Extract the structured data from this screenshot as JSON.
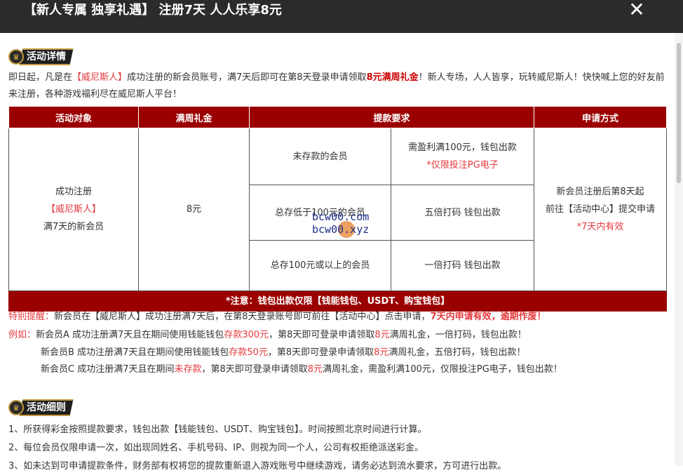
{
  "header": {
    "title": "【新人专属 独享礼遇】 注册7天 人人乐享8元",
    "close_label": "✕"
  },
  "section1": {
    "badge_label": "活动详情",
    "intro_1": "即日起，凡是在",
    "intro_brand": "【威尼斯人】",
    "intro_2": "成功注册的新会员账号，满7天后即可在第8天登录申请领取",
    "intro_gift": "8元满周礼金",
    "intro_3": "！新人专场，人人皆享，玩转威尼斯人！快快喊上您的好友前来注册，各种游戏福利尽在威尼斯人平台！"
  },
  "table": {
    "headers": [
      "活动对象",
      "满周礼金",
      "提款要求",
      "申请方式"
    ],
    "target_1": "成功注册",
    "target_brand": "【威尼斯人】",
    "target_2": "满7天的新会员",
    "amount": "8元",
    "rows": [
      {
        "condition": "未存款的会员",
        "req_1": "需盈利满100元，钱包出款",
        "req_2": "*仅限投注PG电子"
      },
      {
        "condition": "总存低于100元的会员",
        "req_1": "五倍打码 钱包出款",
        "req_2": ""
      },
      {
        "condition": "总存100元或以上的会员",
        "req_1": "一倍打码 钱包出款",
        "req_2": ""
      }
    ],
    "apply_1": "新会员注册后第8天起",
    "apply_2": "前往【活动中心】提交申请",
    "apply_3": "*7天内有效",
    "note": "*注意：钱包出款仅限【钱能钱包、USDT、购宝钱包】"
  },
  "reminder": {
    "label": "特别提醒：",
    "text": "新会员在【威尼斯人】成功注册满7天后，在第8天登录账号即可前往【活动中心】点击申请，",
    "emphasis": "7天内申请有效，逾期作废！"
  },
  "examples": {
    "label": "例如：",
    "a_1": "新会员A  成功注册满7天且在期间使用钱能钱包",
    "a_dep": "存款300元",
    "a_2": "，第8天即可登录申请领取",
    "a_amt": "8元",
    "a_3": "满周礼金，一倍打码，钱包出款！",
    "b_1": "新会员B  成功注册满7天且在期间使用钱能钱包",
    "b_dep": "存款50元",
    "b_2": "，第8天即可登录申请领取",
    "b_amt": "8元",
    "b_3": "满周礼金，五倍打码，钱包出款！",
    "c_1": "新会员C  成功注册满7天且在期间",
    "c_dep": "未存款",
    "c_2": "，第8天即可登录申请领取",
    "c_amt": "8元",
    "c_3": "满周礼金，需盈利满100元，仅限投注PG电子，钱包出款！"
  },
  "section2": {
    "badge_label": "活动细则",
    "rule_1": "1、所获得彩金按照提款要求，钱包出款【钱能钱包、USDT、购宝钱包】。时间按照北京时间进行计算。",
    "rule_2": "2、每位会员仅限申请一次，如出现同姓名、手机号码、IP、则视为同一个人，公司有权拒绝派送彩金。",
    "rule_3": "3、如未达到可申请提款条件，财务部有权将您的提款重新退入游戏账号中继续游戏，请务必达到流水要求，方可进行出款。"
  },
  "watermark": {
    "line_1": "bcw00.com",
    "line_2": "bcw00.xyz"
  },
  "colors": {
    "header_bg": "#2b2b2b",
    "table_header_bg": "#9b0000",
    "highlight_red": "#e4393c",
    "badge_gold": "#c49a3a"
  }
}
